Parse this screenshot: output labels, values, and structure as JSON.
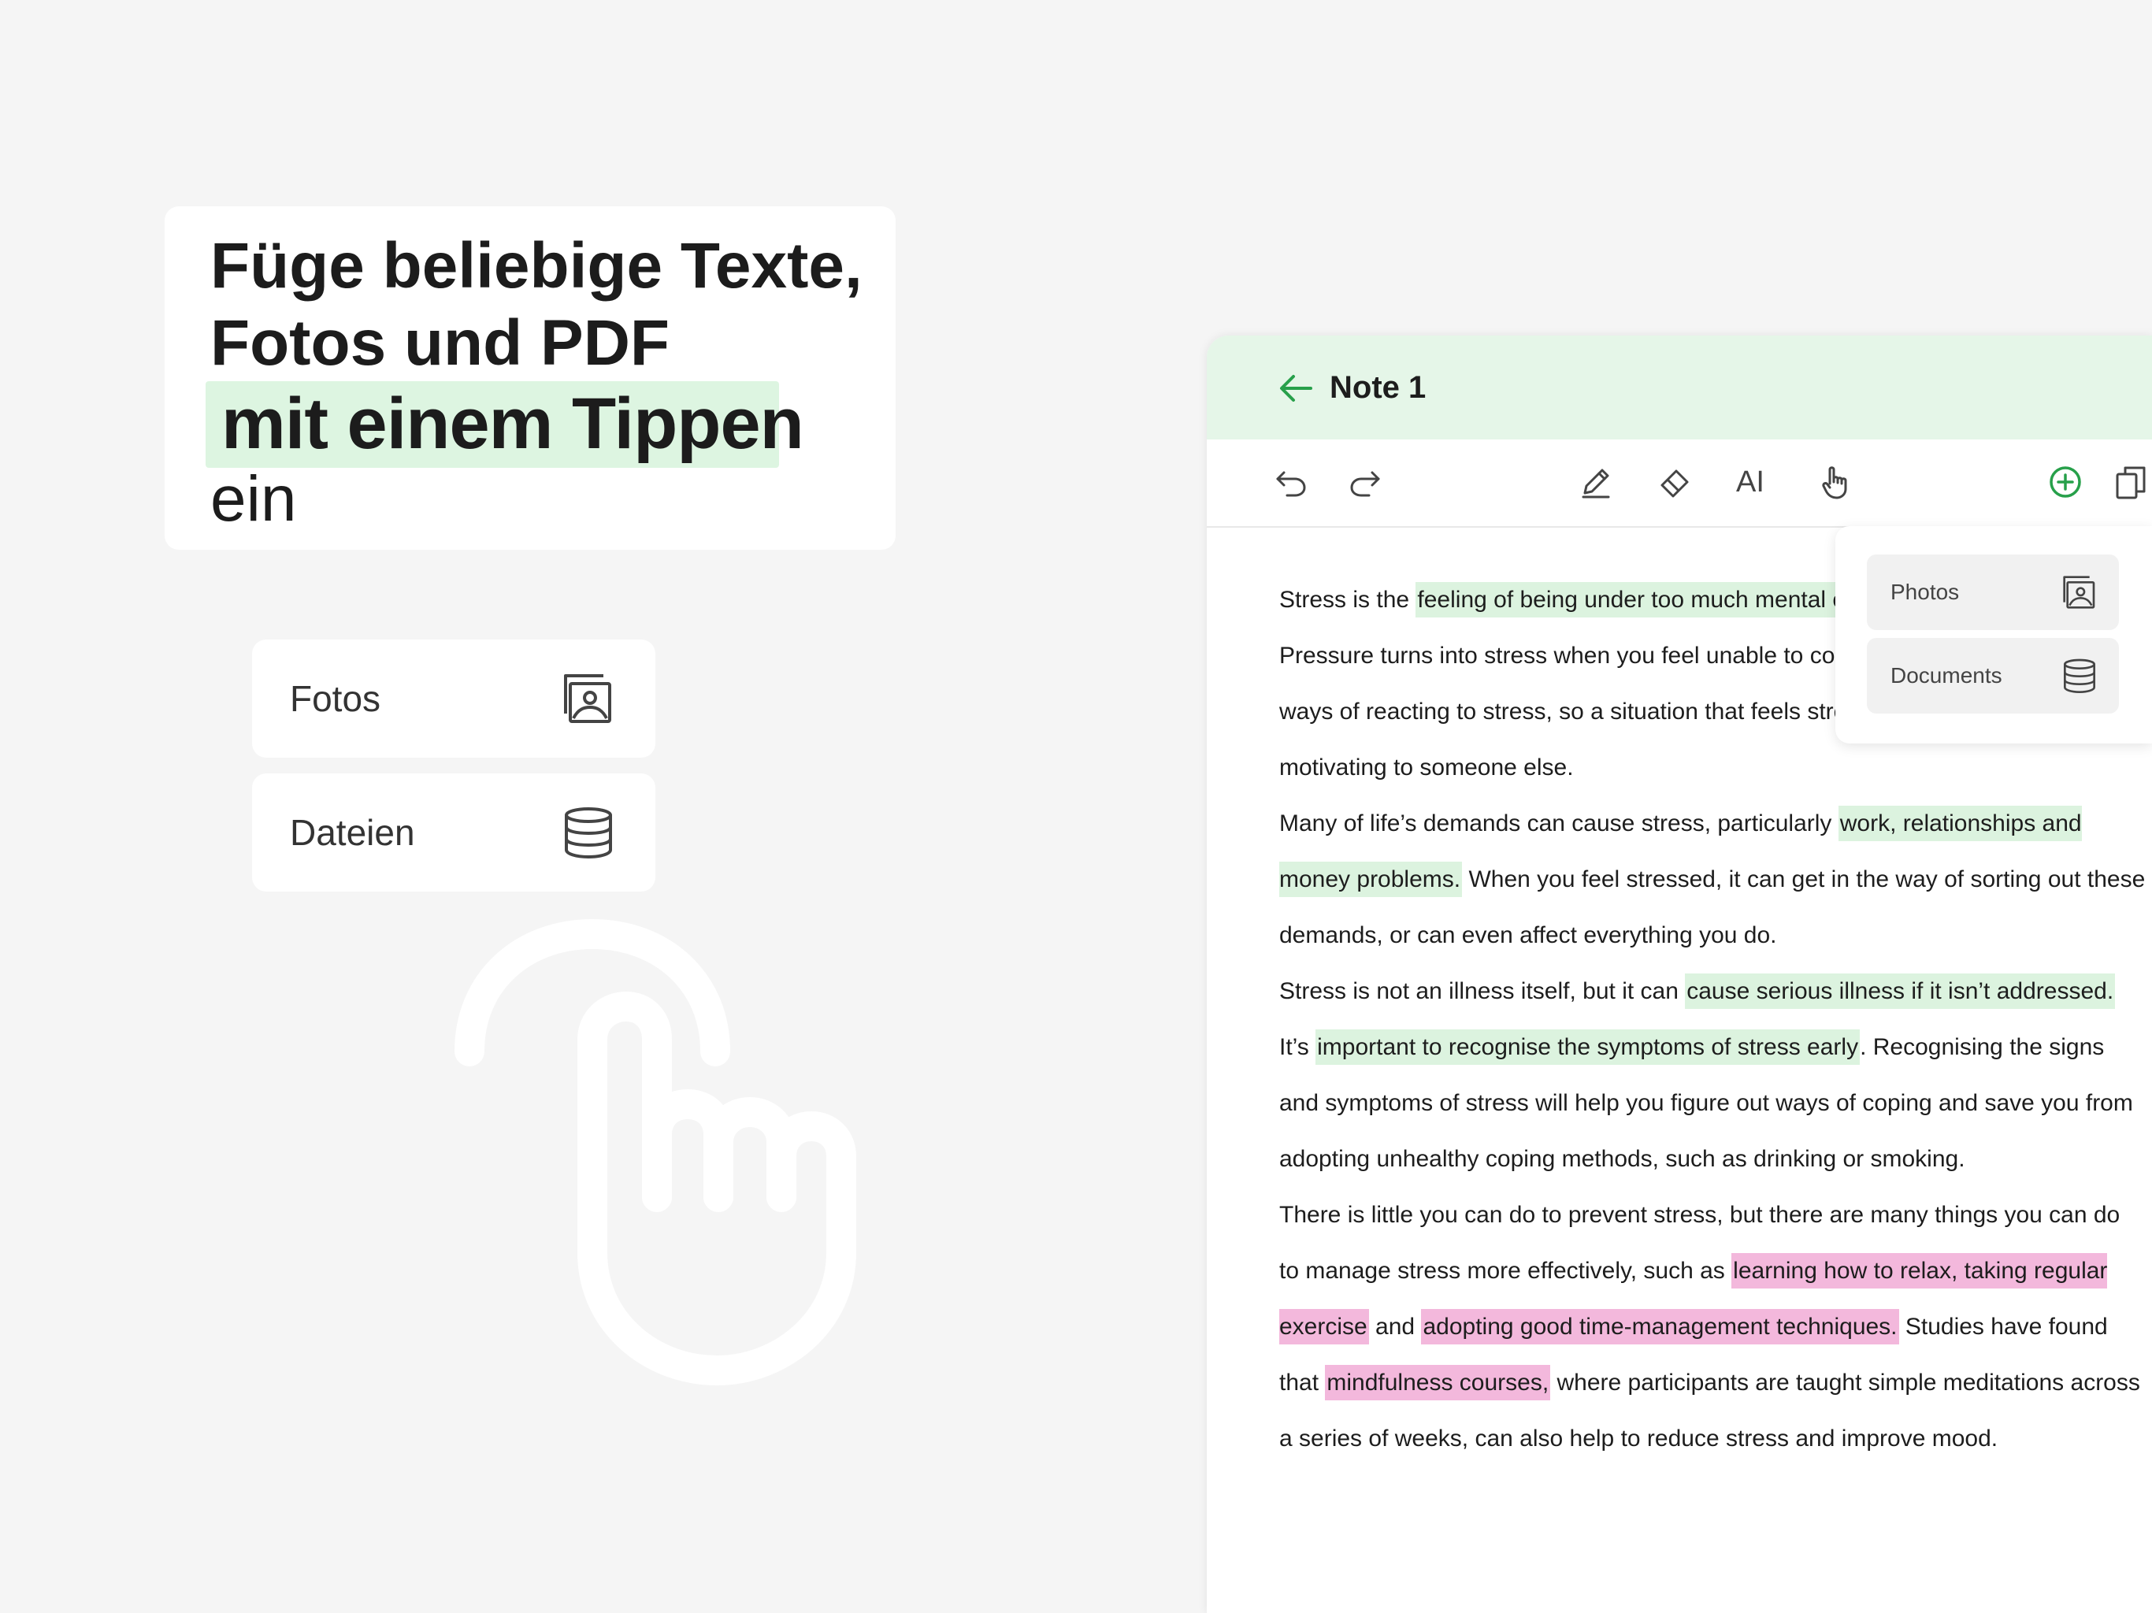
{
  "headline": {
    "line1": "Füge beliebige Texte,",
    "line2": "Fotos und PDF",
    "line3": "mit einem Tippen",
    "line4": "ein"
  },
  "options": {
    "fotos": "Fotos",
    "dateien": "Dateien"
  },
  "note": {
    "title": "Note 1",
    "toolbar": {
      "undo": "undo-icon",
      "redo": "redo-icon",
      "pen": "pen-icon",
      "eraser": "eraser-icon",
      "text_tool": "AI",
      "hand": "hand-icon",
      "add": "add-circle-icon",
      "pages": "pages-icon"
    },
    "paragraphs": {
      "p1": {
        "a": "Stress is the ",
        "b": "feeling of being under too much mental or emotional pressure.",
        "c": " Pressure turns into stress when you feel unable to cope. People have different ways of reacting to stress, so a situation that feels stressful to one person may be motivating to someone else."
      },
      "p2": {
        "a": "Many of life’s demands can cause stress, particularly ",
        "b": "work, relationships and money problems.",
        "c": " When you feel stressed, it can get in the way of sorting out these demands, or can even affect everything you do."
      },
      "p3": {
        "a": "Stress is not an illness itself, but it can ",
        "b": "cause serious illness if it isn’t addressed.",
        "c": " It’s ",
        "d": "important to recognise the symptoms of stress early",
        "e": ". Recognising the signs and symptoms of stress will help you figure out ways of coping and save you from adopting unhealthy coping methods, such as drinking or smoking."
      },
      "p4": {
        "a": "There is little you can do to prevent stress, but there are many things you can do to manage stress more effectively, such as ",
        "b": "learning how to relax, taking regular exercise",
        "c": " and ",
        "d": "adopting good time-management techniques.",
        "e": " Studies have found that ",
        "f": "mindfulness courses,",
        "g": " where participants are taught simple meditations across a series of weeks, can also help to reduce stress and improve mood."
      }
    }
  },
  "dropdown": {
    "photos": "Photos",
    "documents": "Documents"
  },
  "colors": {
    "accent_green": "#27a04a",
    "header_bg": "#e5f6e8",
    "highlight_green": "#dcf3df",
    "highlight_pink": "#f3b8dc"
  }
}
